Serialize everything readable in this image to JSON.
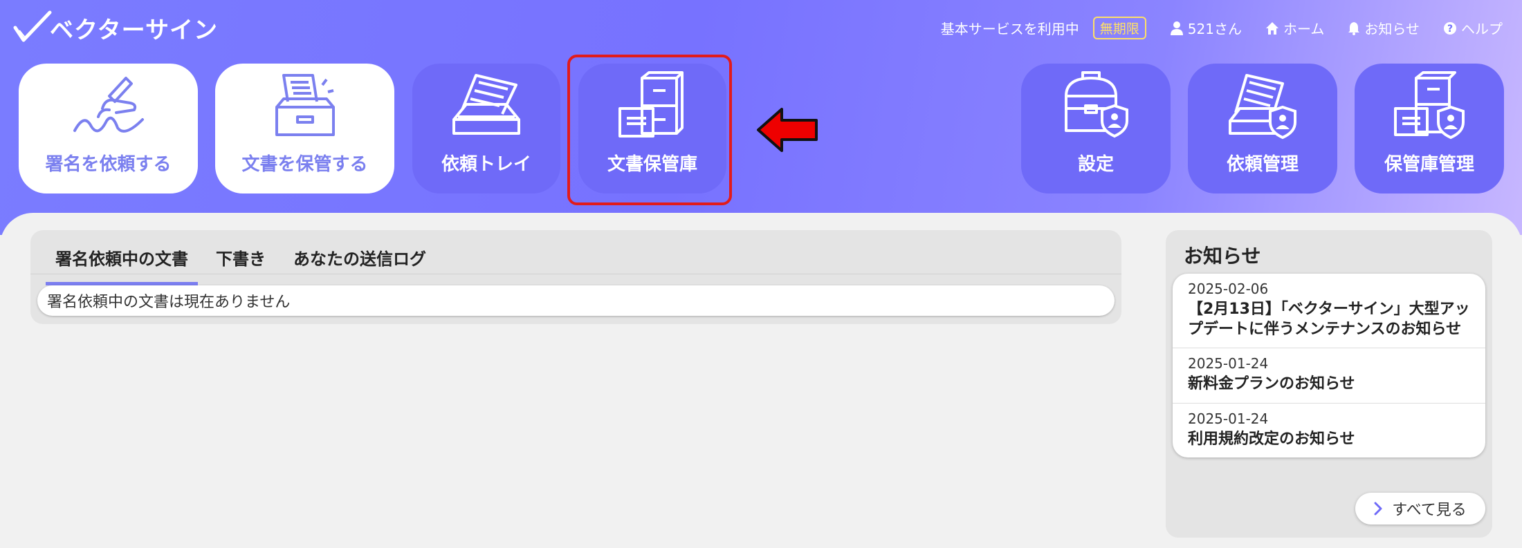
{
  "app": {
    "logo_text": "ベクターサイン"
  },
  "topnav": {
    "service_status": "基本サービスを利用中",
    "plan_badge": "無期限",
    "user": "521さん",
    "home": "ホーム",
    "notices": "お知らせ",
    "help": "ヘルプ"
  },
  "tiles": {
    "request_signature": "署名を依頼する",
    "store_document": "文書を保管する",
    "request_tray": "依頼トレイ",
    "document_vault": "文書保管庫",
    "settings": "設定",
    "request_management": "依頼管理",
    "vault_management": "保管庫管理"
  },
  "documents": {
    "tabs": [
      "署名依頼中の文書",
      "下書き",
      "あなたの送信ログ"
    ],
    "active_tab": 0,
    "empty_message": "署名依頼中の文書は現在ありません"
  },
  "news": {
    "title": "お知らせ",
    "items": [
      {
        "date": "2025-02-06",
        "text": "【2月13日】「ベクターサイン」大型アップデートに伴うメンテナンスのお知らせ"
      },
      {
        "date": "2025-01-24",
        "text": "新料金プランのお知らせ"
      },
      {
        "date": "2025-01-24",
        "text": "利用規約改定のお知らせ"
      }
    ],
    "see_all": "すべて見る"
  },
  "colors": {
    "accent": "#6f6af8",
    "tile_label_light": "#7b80ef",
    "highlight": "#e21b1b",
    "badge": "#ffe066"
  },
  "icons": [
    "checkmark-logo-icon",
    "user-icon",
    "home-icon",
    "bell-icon",
    "help-icon",
    "signing-hand-icon",
    "document-box-icon",
    "tray-icon",
    "cabinet-icon",
    "toolbox-shield-icon",
    "tray-shield-icon",
    "cabinet-shield-icon",
    "red-arrow-icon",
    "chevron-right-icon"
  ]
}
